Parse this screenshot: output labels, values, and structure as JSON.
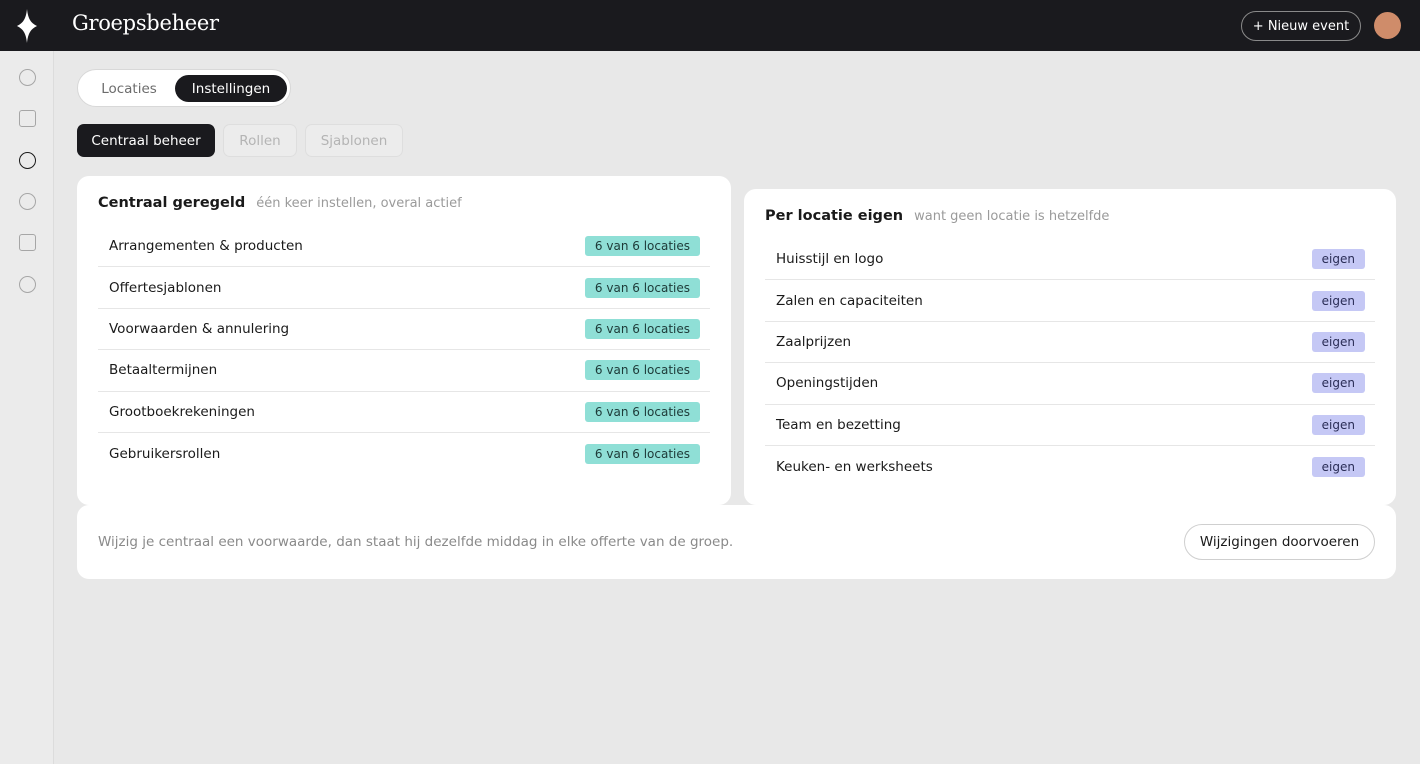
{
  "app": {
    "title": "Groepsbeheer",
    "new_event_label": "+ Nieuw event"
  },
  "sidebar": {
    "items": [
      {
        "icon": "circle-icon",
        "active": false
      },
      {
        "icon": "square-icon",
        "active": false
      },
      {
        "icon": "circle-icon",
        "active": true
      },
      {
        "icon": "circle-icon",
        "active": false
      },
      {
        "icon": "square-icon",
        "active": false
      },
      {
        "icon": "circle-icon",
        "active": false
      }
    ]
  },
  "segment": {
    "options": [
      "Locaties",
      "Instellingen"
    ],
    "selected": "Instellingen"
  },
  "subtabs": [
    {
      "label": "Centraal beheer",
      "state": "active"
    },
    {
      "label": "Rollen",
      "state": "disabled"
    },
    {
      "label": "Sjablonen",
      "state": "disabled"
    }
  ],
  "central": {
    "heading": "Centraal geregeld",
    "subheading": "één keer instellen, overal actief",
    "rows": [
      {
        "label": "Arrangementen & producten",
        "badge": "6 van 6 locaties"
      },
      {
        "label": "Offertesjablonen",
        "badge": "6 van 6 locaties"
      },
      {
        "label": "Voorwaarden & annulering",
        "badge": "6 van 6 locaties"
      },
      {
        "label": "Betaaltermijnen",
        "badge": "6 van 6 locaties"
      },
      {
        "label": "Grootboekrekeningen",
        "badge": "6 van 6 locaties"
      },
      {
        "label": "Gebruikersrollen",
        "badge": "6 van 6 locaties"
      }
    ]
  },
  "per_location": {
    "heading": "Per locatie eigen",
    "subheading": "want geen locatie is hetzelfde",
    "rows": [
      {
        "label": "Huisstijl en logo",
        "badge": "eigen"
      },
      {
        "label": "Zalen en capaciteiten",
        "badge": "eigen"
      },
      {
        "label": "Zaalprijzen",
        "badge": "eigen"
      },
      {
        "label": "Openingstijden",
        "badge": "eigen"
      },
      {
        "label": "Team en bezetting",
        "badge": "eigen"
      },
      {
        "label": "Keuken- en werksheets",
        "badge": "eigen"
      }
    ]
  },
  "footer": {
    "note": "Wijzig je centraal een voorwaarde, dan staat hij dezelfde middag in elke offerte van de groep.",
    "button": "Wijzigingen doorvoeren"
  },
  "colors": {
    "topbar": "#1a1a1e",
    "central_badge": "#8fdfd6",
    "own_badge": "#c5c8f5",
    "avatar": "#cf8c6a"
  }
}
